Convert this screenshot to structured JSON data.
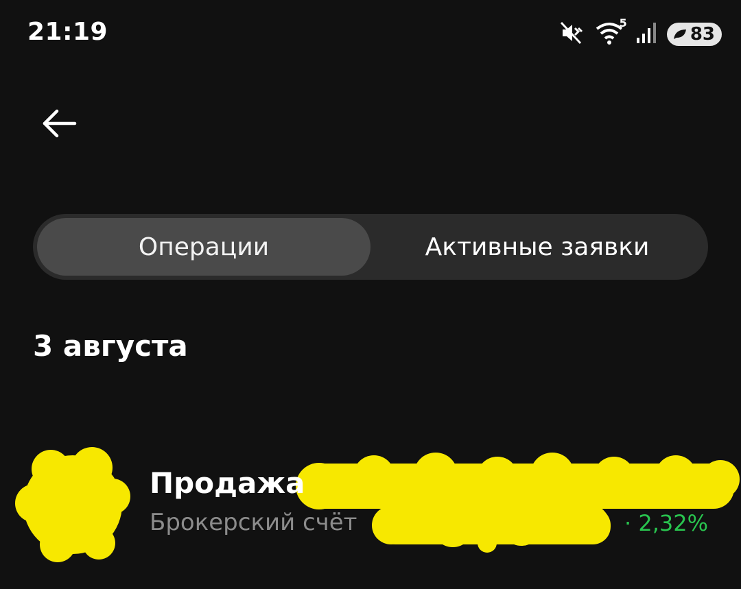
{
  "status_bar": {
    "time": "21:19",
    "battery_percent": "83",
    "wifi_label": "5",
    "icons": [
      "mute-icon",
      "wifi-icon",
      "signal-icon",
      "battery-icon"
    ]
  },
  "tabs": [
    {
      "label": "Операции",
      "active": true
    },
    {
      "label": "Активные заявки",
      "active": false
    }
  ],
  "section": {
    "date": "3 августа"
  },
  "operations": [
    {
      "title": "Продажа",
      "subtitle": "Брокерский счёт",
      "change": "· 2,32%",
      "change_color": "#29c44f"
    }
  ],
  "colors": {
    "background": "#111111",
    "segment_bg": "#2b2b2b",
    "segment_active": "#4a4a4a",
    "redaction": "#f7e800"
  }
}
